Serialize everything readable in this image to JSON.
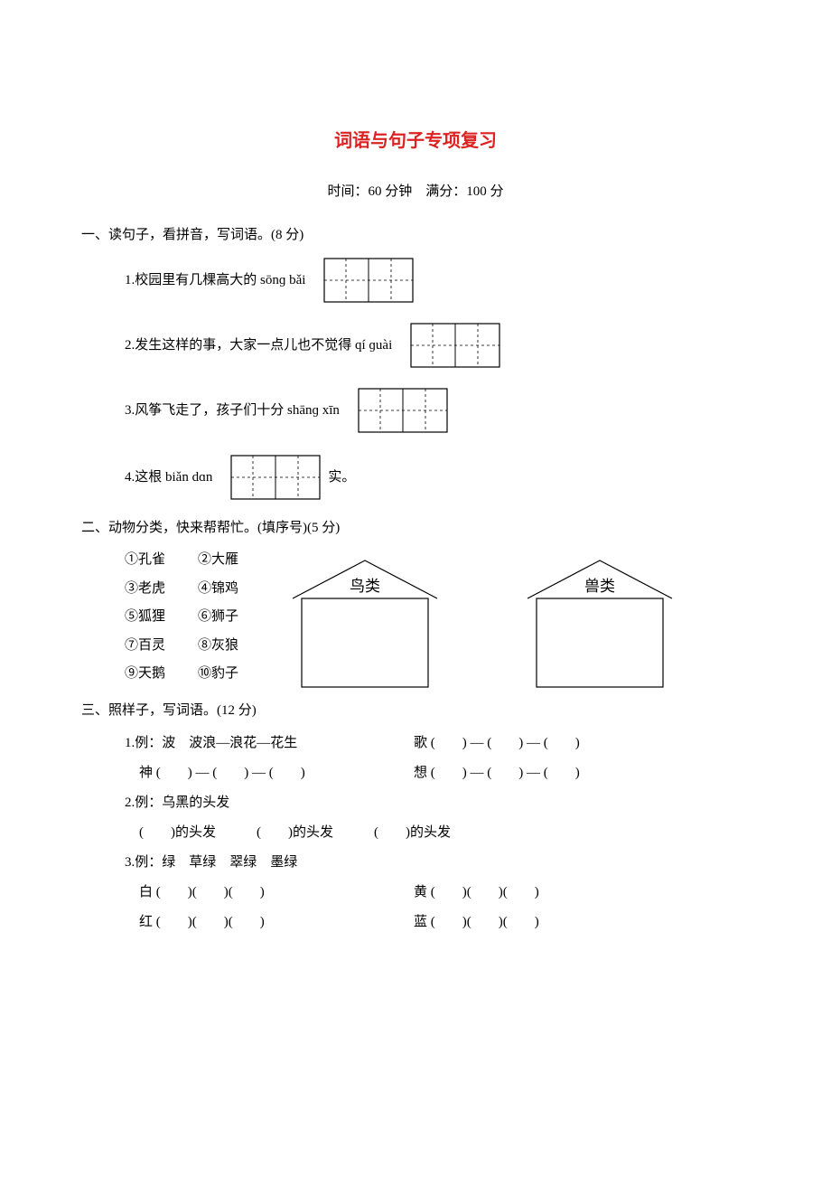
{
  "title": "词语与句子专项复习",
  "meta": "时间：60 分钟　满分：100 分",
  "s1": {
    "heading": "一、读句子，看拼音，写词语。(8 分)",
    "q1": "1.校园里有几棵高大的 sōnɡ bǎi",
    "q2": "2.发生这样的事，大家一点儿也不觉得 qí ɡuài",
    "q3": "3.风筝飞走了，孩子们十分 shānɡ xīn",
    "q4a": "4.这根 biǎn dɑn",
    "q4b": "实。"
  },
  "s2": {
    "heading": "二、动物分类，快来帮帮忙。(填序号)(5 分)",
    "row1a": "①孔雀",
    "row1b": "②大雁",
    "row2a": "③老虎",
    "row2b": "④锦鸡",
    "row3a": "⑤狐狸",
    "row3b": "⑥狮子",
    "row4a": "⑦百灵",
    "row4b": "⑧灰狼",
    "row5a": "⑨天鹅",
    "row5b": "⑩豹子",
    "house1": "鸟类",
    "house2": "兽类"
  },
  "s3": {
    "heading": "三、照样子，写词语。(12 分)",
    "l1a": "1.例：波　波浪—浪花—花生",
    "l1b": "歌 (　　) — (　　) — (　　)",
    "l2a": "神 (　　) — (　　) — (　　)",
    "l2b": "想 (　　) — (　　) — (　　)",
    "l3": "2.例：乌黑的头发",
    "l4": "(　　)的头发　　　(　　)的头发　　　(　　)的头发",
    "l5": "3.例：绿　草绿　翠绿　墨绿",
    "l6a": "白 (　　)(　　)(　　)",
    "l6b": "黄 (　　)(　　)(　　)",
    "l7a": "红 (　　)(　　)(　　)",
    "l7b": "蓝 (　　)(　　)(　　)"
  }
}
